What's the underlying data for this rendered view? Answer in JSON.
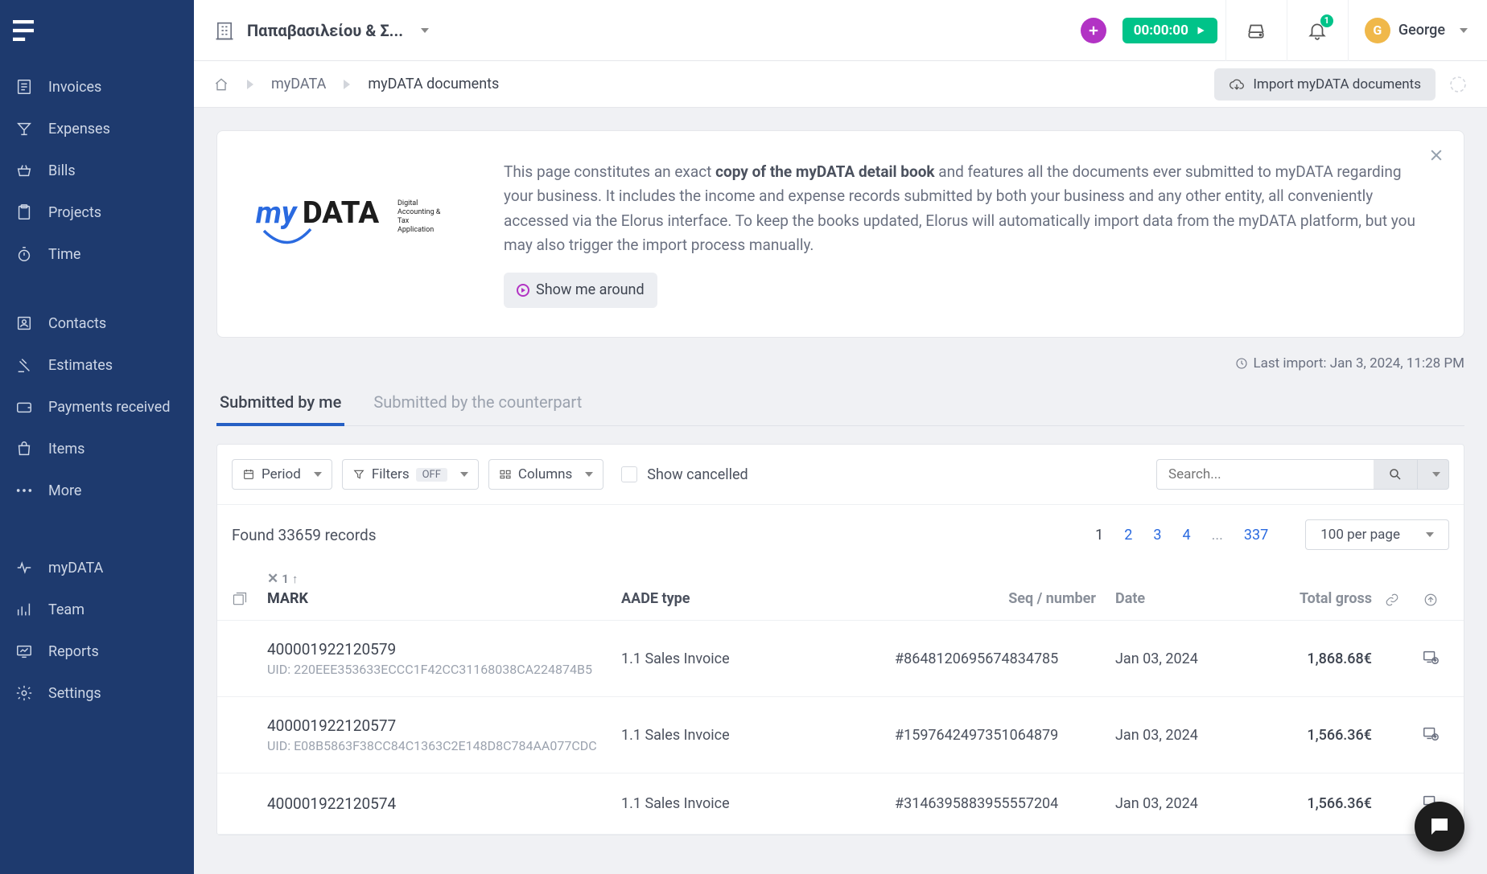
{
  "sidebar": {
    "items_a": [
      {
        "label": "Invoices"
      },
      {
        "label": "Expenses"
      },
      {
        "label": "Bills"
      },
      {
        "label": "Projects"
      },
      {
        "label": "Time"
      }
    ],
    "items_b": [
      {
        "label": "Contacts"
      },
      {
        "label": "Estimates"
      },
      {
        "label": "Payments received"
      },
      {
        "label": "Items"
      },
      {
        "label": "More"
      }
    ],
    "items_c": [
      {
        "label": "myDATA"
      },
      {
        "label": "Team"
      },
      {
        "label": "Reports"
      },
      {
        "label": "Settings"
      }
    ]
  },
  "topbar": {
    "company_name": "Παπαβασιλείου & Σ...",
    "timer": "00:00:00",
    "notif_count": "1",
    "user_initial": "G",
    "user_name": "George"
  },
  "breadcrumb": {
    "level1": "myDATA",
    "level2": "myDATA documents",
    "import_button": "Import myDATA documents"
  },
  "info": {
    "logo_brand": "myDATA",
    "logo_sub1": "Digital",
    "logo_sub2": "Accounting &",
    "logo_sub3": "Tax",
    "logo_sub4": "Application",
    "text_pre": "This page constitutes an exact ",
    "text_bold": "copy of the myDATA detail book",
    "text_post": " and features all the documents ever submitted to myDATA regarding your business. It includes the income and expense records submitted by both your business and any other entity, all conveniently accessed via the Elorus interface. To keep the books updated, Elorus will automatically import data from the myDATA platform, but you may also trigger the import process manually.",
    "show_me": "Show me around"
  },
  "last_import": "Last import: Jan 3, 2024, 11:28 PM",
  "tabs": {
    "t1": "Submitted by me",
    "t2": "Submitted by the counterpart"
  },
  "toolbar": {
    "period": "Period",
    "filters": "Filters",
    "filters_state": "OFF",
    "columns": "Columns",
    "show_cancelled": "Show cancelled",
    "search_placeholder": "Search..."
  },
  "records": {
    "found_text": "Found 33659 records",
    "pages": [
      "1",
      "2",
      "3",
      "4",
      "...",
      "337"
    ],
    "current_page": "1",
    "per_page": "100 per page"
  },
  "table": {
    "sort_num": "1",
    "headers": {
      "mark": "MARK",
      "type": "AADE type",
      "seq": "Seq / number",
      "date": "Date",
      "gross": "Total gross"
    },
    "rows": [
      {
        "mark": "400001922120579",
        "uid": "UID: 220EEE353633ECCC1F42CC31168038CA224874B5",
        "type": "1.1 Sales Invoice",
        "seq": "#8648120695674834785",
        "date": "Jan 03, 2024",
        "gross": "1,868.68€"
      },
      {
        "mark": "400001922120577",
        "uid": "UID: E08B5863F38CC84C1363C2E148D8C784AA077CDC",
        "type": "1.1 Sales Invoice",
        "seq": "#1597642497351064879",
        "date": "Jan 03, 2024",
        "gross": "1,566.36€"
      },
      {
        "mark": "400001922120574",
        "uid": "",
        "type": "1.1 Sales Invoice",
        "seq": "#3146395883955557204",
        "date": "Jan 03, 2024",
        "gross": "1,566.36€"
      }
    ]
  }
}
